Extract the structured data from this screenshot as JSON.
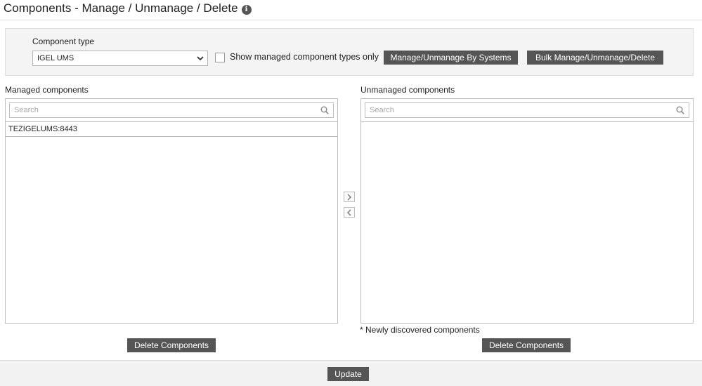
{
  "page": {
    "title": "Components - Manage / Unmanage / Delete",
    "info_icon": "info-icon"
  },
  "filter": {
    "component_type_label": "Component type",
    "component_type_value": "IGEL UMS",
    "show_managed_label": "Show managed component types only",
    "show_managed_checked": false,
    "manage_by_systems_label": "Manage/Unmanage By Systems",
    "bulk_label": "Bulk Manage/Unmanage/Delete"
  },
  "managed": {
    "label": "Managed components",
    "search_placeholder": "Search",
    "items": [
      "TEZIGELUMS:8443"
    ],
    "delete_label": "Delete Components"
  },
  "unmanaged": {
    "label": "Unmanaged components",
    "search_placeholder": "Search",
    "items": [],
    "footnote": "* Newly discovered components",
    "delete_label": "Delete Components"
  },
  "footer": {
    "update_label": "Update"
  },
  "colors": {
    "button_bg": "#555555",
    "panel_bg": "#f4f4f4",
    "border": "#bdbdbd"
  }
}
